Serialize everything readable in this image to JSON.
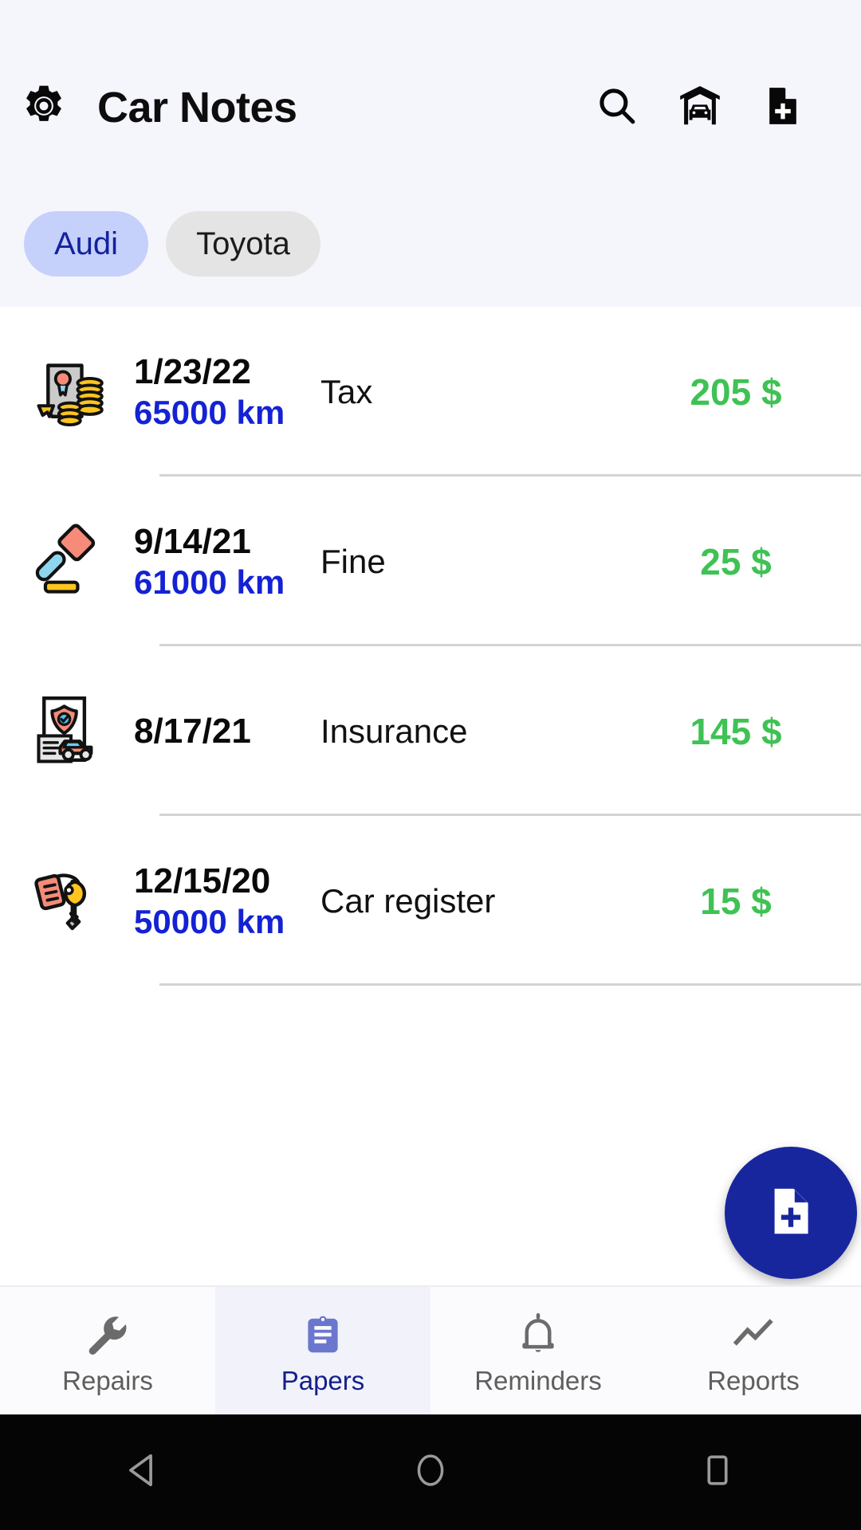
{
  "header": {
    "title": "Car Notes",
    "settings_icon": "gear-icon",
    "search_icon": "search-icon",
    "garage_icon": "garage-car-icon",
    "add_document_icon": "document-plus-icon",
    "background_color": "#F5F5FC"
  },
  "car_chips": {
    "selected_index": 0,
    "selected_bg": "#C5D0FB",
    "selected_text_color": "#13229B",
    "unselected_bg": "#E4E4E4",
    "items": [
      {
        "label": "Audi",
        "selected": true
      },
      {
        "label": "Toyota",
        "selected": false
      }
    ]
  },
  "papers": {
    "amount_color": "#3FC254",
    "km_color": "#1422D4",
    "rows": [
      {
        "icon": "certificate-coins-icon",
        "date": "1/23/22",
        "odometer": "65000 km",
        "title": "Tax",
        "amount": "205 $"
      },
      {
        "icon": "gavel-icon",
        "date": "9/14/21",
        "odometer": "61000 km",
        "title": "Fine",
        "amount": "25 $"
      },
      {
        "icon": "insurance-document-car-icon",
        "date": "8/17/21",
        "odometer": "",
        "title": "Insurance",
        "amount": "145 $"
      },
      {
        "icon": "car-keys-icon",
        "date": "12/15/20",
        "odometer": "50000 km",
        "title": "Car register",
        "amount": "15 $"
      }
    ]
  },
  "fab": {
    "icon": "document-plus-icon",
    "background_color": "#18269E",
    "icon_color": "#FFFFFF"
  },
  "bottom_nav": {
    "active_index": 1,
    "active_color": "#131F8C",
    "inactive_color": "#5E5E5E",
    "items": [
      {
        "label": "Repairs",
        "icon": "wrench-icon",
        "active": false
      },
      {
        "label": "Papers",
        "icon": "clipboard-icon",
        "active": true
      },
      {
        "label": "Reminders",
        "icon": "bell-icon",
        "active": false
      },
      {
        "label": "Reports",
        "icon": "trend-line-icon",
        "active": false
      }
    ]
  },
  "system_nav": {
    "background_color": "#050505",
    "buttons": [
      {
        "name": "back-button",
        "icon": "triangle-back-icon"
      },
      {
        "name": "home-button",
        "icon": "circle-home-icon"
      },
      {
        "name": "recents-button",
        "icon": "square-recents-icon"
      }
    ]
  }
}
